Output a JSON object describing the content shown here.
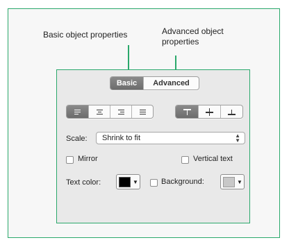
{
  "callouts": {
    "basic": "Basic object properties",
    "advanced": "Advanced object properties"
  },
  "tabs": [
    {
      "label": "Basic",
      "selected": true
    },
    {
      "label": "Advanced",
      "selected": false
    }
  ],
  "text_align": {
    "icons": [
      "align-left-icon",
      "align-center-icon",
      "align-right-icon",
      "align-justify-icon"
    ],
    "selected": 0
  },
  "vertical_align": {
    "icons": [
      "align-top-icon",
      "align-middle-icon",
      "align-bottom-icon"
    ],
    "selected": 0
  },
  "scale": {
    "label": "Scale:",
    "value": "Shrink to fit",
    "arrows": "⌃⌄"
  },
  "mirror": {
    "label": "Mirror",
    "checked": false
  },
  "vertical_text": {
    "label": "Vertical text",
    "checked": false
  },
  "text_color": {
    "label": "Text color:",
    "color": "#000000"
  },
  "background": {
    "label": "Background:",
    "checked": false,
    "color": "#c8c8c8"
  },
  "colors": {
    "accent": "#2aa86b",
    "selected_segment": "#7a7a7a"
  }
}
